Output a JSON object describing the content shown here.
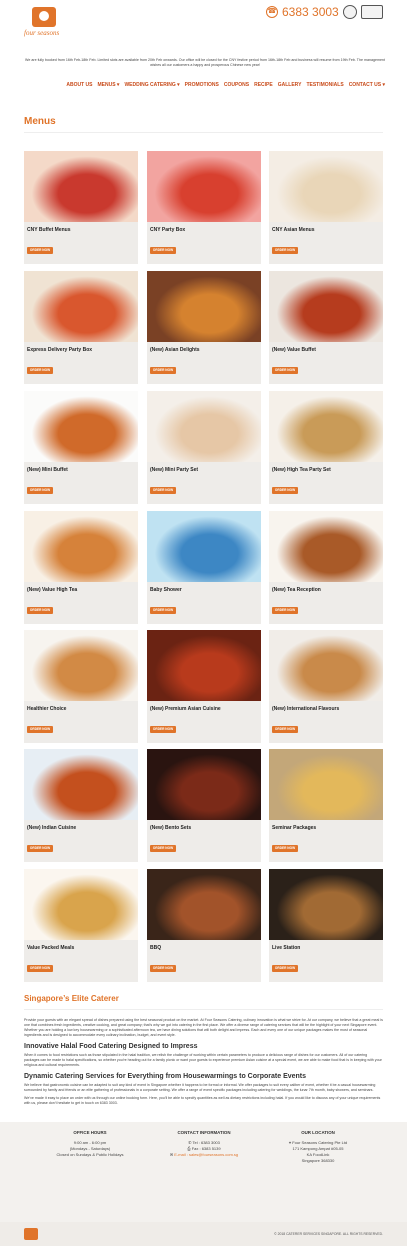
{
  "header": {
    "brand": "four seasons",
    "phone": "6383 3003",
    "notice": "We are fully booked from 16th Feb-18th Feb. Limited slots are available from 20th Feb onwards. Our office will be closed for the CNY festive period from 16th-18th Feb and business will resume from 19th Feb. The management wishes all our customers a happy and prosperous Chinese new year!"
  },
  "nav": [
    "ABOUT US",
    "MENUS ▾",
    "WEDDING CATERING ▾",
    "PROMOTIONS",
    "COUPONS",
    "RECIPE",
    "GALLERY",
    "TESTIMONIALS",
    "CONTACT US ▾"
  ],
  "menus": {
    "title": "Menus",
    "button_label": "ORDER NOW",
    "items": [
      {
        "label": "CNY Buffet Menus",
        "palette": [
          "#f4d9c8",
          "#c9392e"
        ]
      },
      {
        "label": "CNY Party Box",
        "palette": [
          "#f2a4a0",
          "#d8402f"
        ]
      },
      {
        "label": "CNY Asian Menus",
        "palette": [
          "#f4ede4",
          "#e9d6b8"
        ]
      },
      {
        "label": "Express Delivery Party Box",
        "palette": [
          "#f0e3d3",
          "#d9572e"
        ]
      },
      {
        "label": "(New) Asian Delights",
        "palette": [
          "#7a4125",
          "#d5822f"
        ]
      },
      {
        "label": "(New) Value Buffet",
        "palette": [
          "#ece6df",
          "#b63c1e"
        ]
      },
      {
        "label": "(New) Mini Buffet",
        "palette": [
          "#fbfbfa",
          "#d06a2a"
        ]
      },
      {
        "label": "(New) Mini Party Set",
        "palette": [
          "#f4efe9",
          "#e6c7a6"
        ]
      },
      {
        "label": "(New) High Tea Party Set",
        "palette": [
          "#f5f0e9",
          "#c99b58"
        ]
      },
      {
        "label": "(New) Value High Tea",
        "palette": [
          "#f8f0e5",
          "#d6823a"
        ]
      },
      {
        "label": "Baby Shower",
        "palette": [
          "#bfe2f2",
          "#3d87c4"
        ]
      },
      {
        "label": "(New) Tea Reception",
        "palette": [
          "#f8f4ee",
          "#a95a28"
        ]
      },
      {
        "label": "Healthier Choice",
        "palette": [
          "#f7f4ef",
          "#d28a45"
        ]
      },
      {
        "label": "(New) Premium Asian Cuisine",
        "palette": [
          "#6b2313",
          "#b83a1c"
        ]
      },
      {
        "label": "(New) International Flavours",
        "palette": [
          "#f1ede8",
          "#c98a4a"
        ]
      },
      {
        "label": "(New) Indian Cuisine",
        "palette": [
          "#e7eef4",
          "#c4501e"
        ]
      },
      {
        "label": "(New) Bento Sets",
        "palette": [
          "#2a1410",
          "#7b2a18"
        ]
      },
      {
        "label": "Seminar Packages",
        "palette": [
          "#c3a779",
          "#e3b85b"
        ]
      },
      {
        "label": "Value Packed Meals",
        "palette": [
          "#fbf6ef",
          "#d9a44c"
        ]
      },
      {
        "label": "BBQ",
        "palette": [
          "#3a2519",
          "#a2532a"
        ]
      },
      {
        "label": "Live Station",
        "palette": [
          "#2b2119",
          "#a16a34"
        ]
      }
    ]
  },
  "about": {
    "title": "Singapore’s Elite Caterer",
    "p1": "Provide your guests with an elegant spread of dishes prepared using the best seasonal product on the market. At Four Seasons Catering, culinary innovation is what we strive for. At our company, we believe that a great meal is one that combines fresh ingredients, creative cooking, and great company; that’s why we got into catering in the first place. We offer a diverse range of catering services that will be the highlight of your next Singapore event. Whether you are holding a low key housewarming or a sophisticated afternoon tea, we have dining solutions that will both delight and impress. Each and every one of our unique packages makes the most of seasonal ingredients and is designed to accommodate every culinary inclination, budget, and event style.",
    "h2": "Innovative Halal Food Catering Designed to Impress",
    "p2": "When it comes to food restrictions such as those stipulated in the halal tradition, we relish the challenge of working within certain parameters to produce a delicious range of dishes for our customers. All of our catering packages can be made to halal specifications, so whether you’re heading out for a family picnic or want your guests to experience premium Asian cuisine at a special event, we are able to make food that is in keeping with your religious and cultural requirements.",
    "h3": "Dynamic Catering Services for Everything from Housewarmings to Corporate Events",
    "p3": "We believe that gastronomic cuisine can be adapted to suit any kind of event in Singapore whether it happens to be formal or informal. We offer packages to suit every caliber of event, whether it be a casual housewarming surrounded by family and friends or an elite gathering of professionals in a corporate setting. We offer a range of event specific packages including catering for weddings, the lunar 7th month, baby showers, and seminars.",
    "p4": "We’ve made it easy to place an order with us through our online booking form. Here, you’ll be able to specify quantities as well as dietary restrictions including halal. If you would like to discuss any of your unique requirements with us, please don’t hesitate to get in touch on 6383 3003."
  },
  "footer": {
    "hours_title": "OFFICE HOURS",
    "hours": [
      "9:00 am - 6:00 pm",
      "(Mondays - Saturdays)",
      "Closed on Sundays & Public Holidays"
    ],
    "contact_title": "CONTACT INFORMATION",
    "contact": [
      "Tel : 6383 3003",
      "Fax : 6383 5139",
      "E-mail : sales@fourseasons.com.sg"
    ],
    "location_title": "OUR LOCATION",
    "location": [
      "Four Seasons Catering Pte Ltd",
      "171 Kampong Ampat #05-05",
      "KA FoodLink",
      "Singapore 368330"
    ],
    "copyright": "© 2018 CATERER SERVICES SINGAPORE. ALL RIGHTS RESERVED."
  }
}
